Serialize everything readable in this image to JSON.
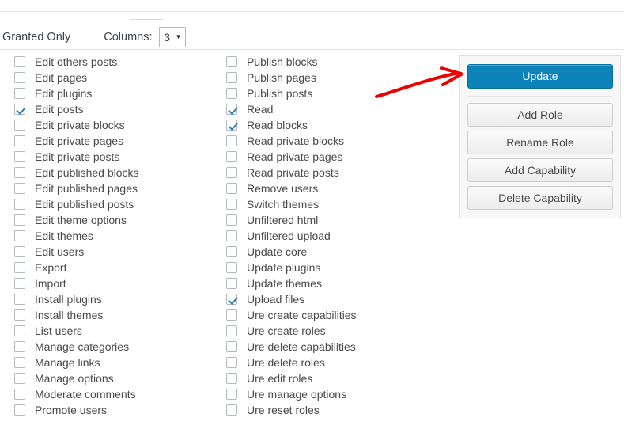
{
  "toolbar": {
    "granted_only_label": "Granted Only",
    "columns_label": "Columns:",
    "columns_value": "3",
    "caret_glyph": "▼"
  },
  "capabilities": {
    "column1": [
      {
        "label": "Edit others posts",
        "checked": false
      },
      {
        "label": "Edit pages",
        "checked": false
      },
      {
        "label": "Edit plugins",
        "checked": false
      },
      {
        "label": "Edit posts",
        "checked": true
      },
      {
        "label": "Edit private blocks",
        "checked": false
      },
      {
        "label": "Edit private pages",
        "checked": false
      },
      {
        "label": "Edit private posts",
        "checked": false
      },
      {
        "label": "Edit published blocks",
        "checked": false
      },
      {
        "label": "Edit published pages",
        "checked": false
      },
      {
        "label": "Edit published posts",
        "checked": false
      },
      {
        "label": "Edit theme options",
        "checked": false
      },
      {
        "label": "Edit themes",
        "checked": false
      },
      {
        "label": "Edit users",
        "checked": false
      },
      {
        "label": "Export",
        "checked": false
      },
      {
        "label": "Import",
        "checked": false
      },
      {
        "label": "Install plugins",
        "checked": false
      },
      {
        "label": "Install themes",
        "checked": false
      },
      {
        "label": "List users",
        "checked": false
      },
      {
        "label": "Manage categories",
        "checked": false
      },
      {
        "label": "Manage links",
        "checked": false
      },
      {
        "label": "Manage options",
        "checked": false
      },
      {
        "label": "Moderate comments",
        "checked": false
      },
      {
        "label": "Promote users",
        "checked": false
      }
    ],
    "column2": [
      {
        "label": "Publish blocks",
        "checked": false
      },
      {
        "label": "Publish pages",
        "checked": false
      },
      {
        "label": "Publish posts",
        "checked": false
      },
      {
        "label": "Read",
        "checked": true
      },
      {
        "label": "Read blocks",
        "checked": true
      },
      {
        "label": "Read private blocks",
        "checked": false
      },
      {
        "label": "Read private pages",
        "checked": false
      },
      {
        "label": "Read private posts",
        "checked": false
      },
      {
        "label": "Remove users",
        "checked": false
      },
      {
        "label": "Switch themes",
        "checked": false
      },
      {
        "label": "Unfiltered html",
        "checked": false
      },
      {
        "label": "Unfiltered upload",
        "checked": false
      },
      {
        "label": "Update core",
        "checked": false
      },
      {
        "label": "Update plugins",
        "checked": false
      },
      {
        "label": "Update themes",
        "checked": false
      },
      {
        "label": "Upload files",
        "checked": true
      },
      {
        "label": "Ure create capabilities",
        "checked": false
      },
      {
        "label": "Ure create roles",
        "checked": false
      },
      {
        "label": "Ure delete capabilities",
        "checked": false
      },
      {
        "label": "Ure delete roles",
        "checked": false
      },
      {
        "label": "Ure edit roles",
        "checked": false
      },
      {
        "label": "Ure manage options",
        "checked": false
      },
      {
        "label": "Ure reset roles",
        "checked": false
      }
    ]
  },
  "actions": {
    "update_label": "Update",
    "add_role_label": "Add Role",
    "rename_role_label": "Rename Role",
    "add_capability_label": "Add Capability",
    "delete_capability_label": "Delete Capability"
  },
  "annotation": {
    "arrow_color": "#ee0000",
    "points_to": "update-button"
  },
  "colors": {
    "primary_button": "#0d82b9",
    "checkmark": "#2b7fb8",
    "panel_background": "#f7f7f7",
    "text": "#4a4a4a",
    "annotation_red": "#ee0000"
  }
}
